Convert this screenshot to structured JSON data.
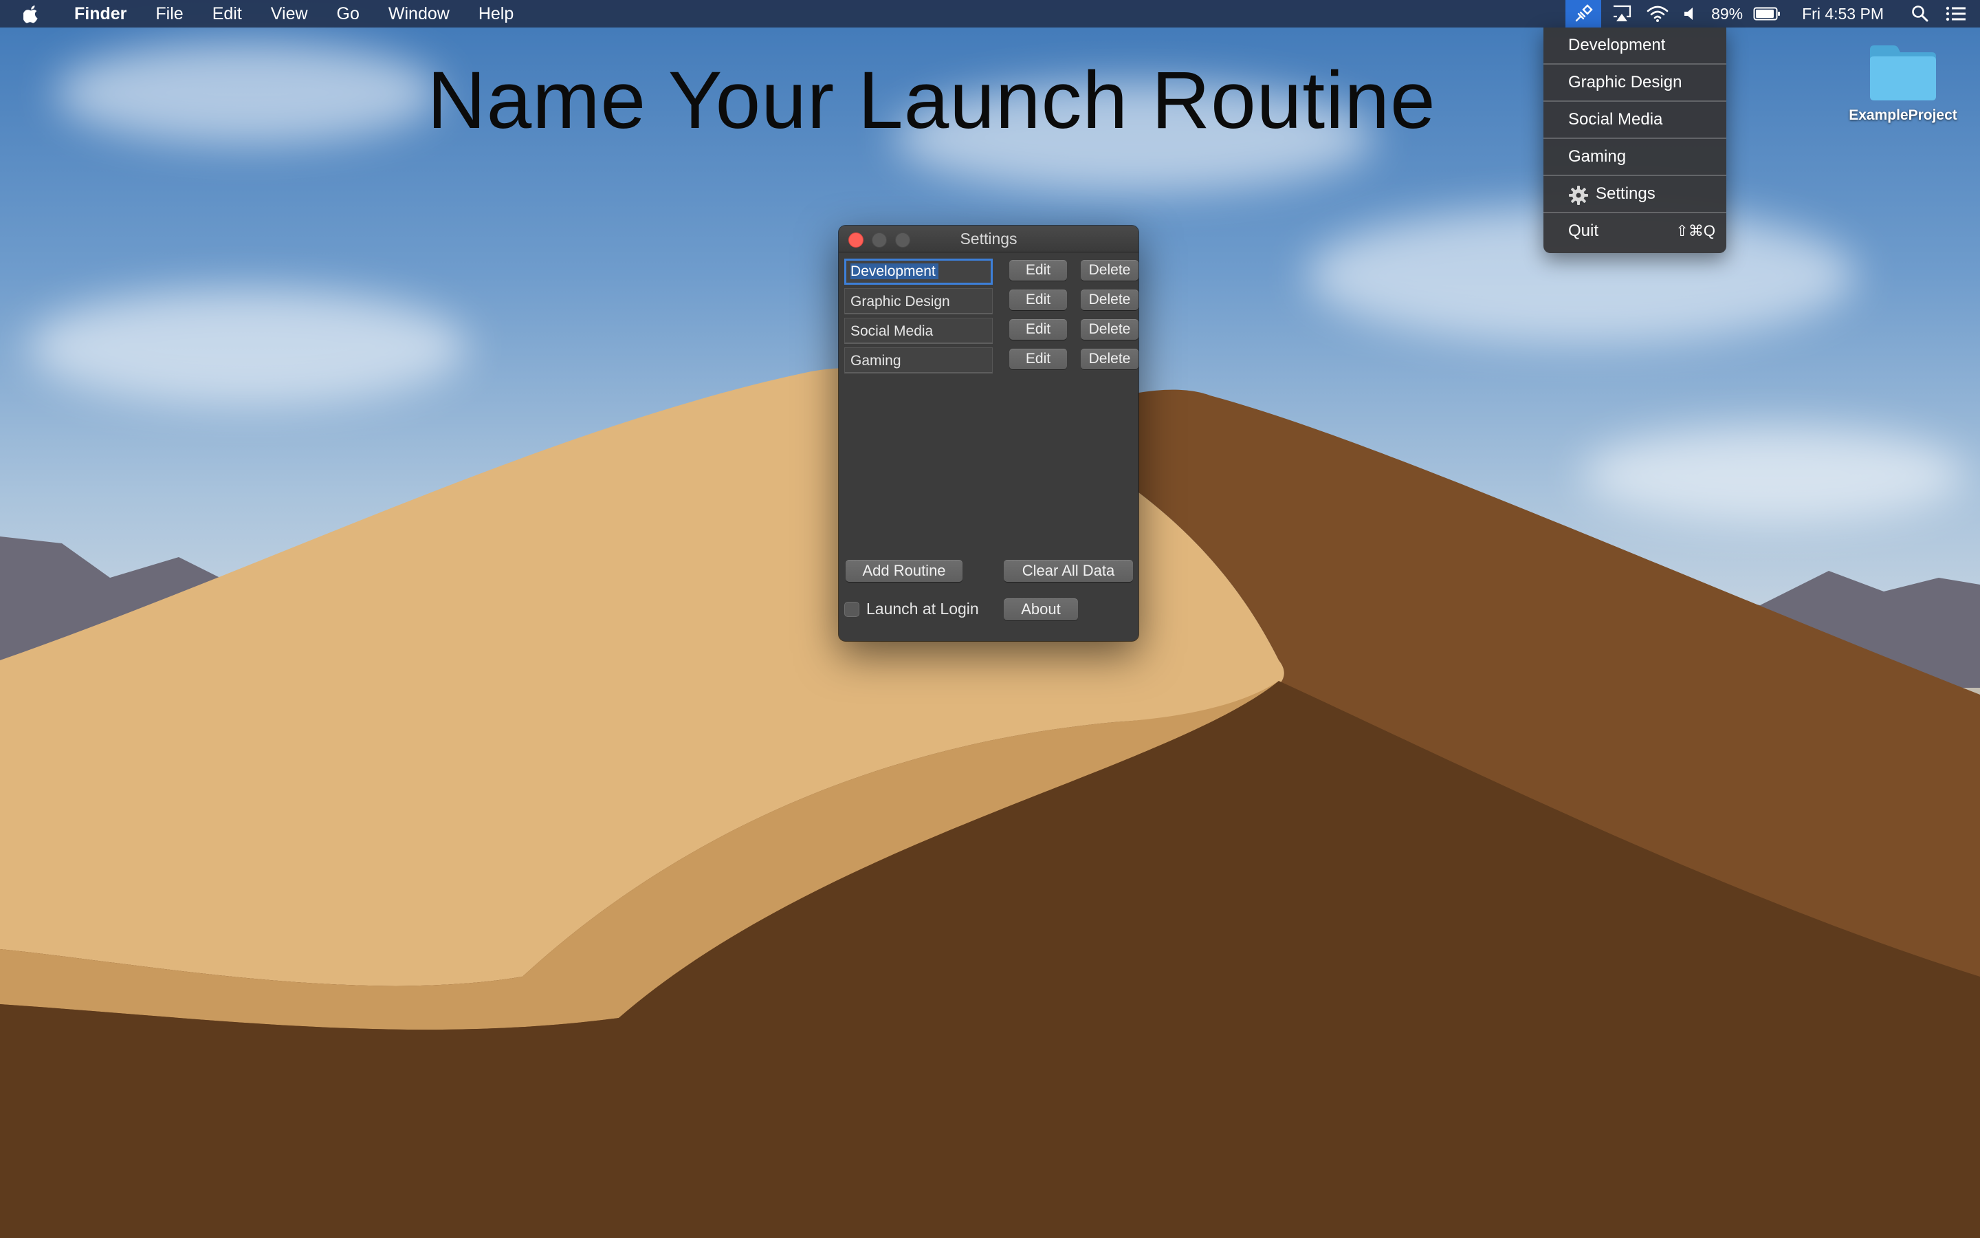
{
  "menubar": {
    "app_name": "Finder",
    "menus": [
      "File",
      "Edit",
      "View",
      "Go",
      "Window",
      "Help"
    ],
    "battery": "89%",
    "clock": "Fri 4:53 PM",
    "icons": [
      "apple-icon",
      "launcher-extension-icon",
      "airplay-icon",
      "wifi-icon",
      "volume-icon",
      "battery-icon",
      "spotlight-search-icon",
      "notification-center-icon"
    ]
  },
  "headline": "Name Your Launch Routine",
  "desktop": {
    "folder_label": "ExampleProject",
    "folder_color": "#5bb8e6"
  },
  "dropdown": {
    "routines": [
      "Development",
      "Graphic Design",
      "Social Media",
      "Gaming"
    ],
    "settings_label": "Settings",
    "quit_label": "Quit",
    "quit_shortcut": "⇧⌘Q"
  },
  "settings_window": {
    "title": "Settings",
    "routines": [
      {
        "name": "Development",
        "edit_label": "Edit",
        "delete_label": "Delete"
      },
      {
        "name": "Graphic Design",
        "edit_label": "Edit",
        "delete_label": "Delete"
      },
      {
        "name": "Social Media",
        "edit_label": "Edit",
        "delete_label": "Delete"
      },
      {
        "name": "Gaming",
        "edit_label": "Edit",
        "delete_label": "Delete"
      }
    ],
    "add_routine_label": "Add Routine",
    "clear_all_label": "Clear All Data",
    "launch_at_login_label": "Launch at Login",
    "launch_at_login_checked": false,
    "about_label": "About"
  },
  "colors": {
    "menubar": "#243452",
    "selection_accent": "#3d7fd8",
    "window_bg": "#3c3c3c",
    "close_button": "#fe5f57"
  }
}
